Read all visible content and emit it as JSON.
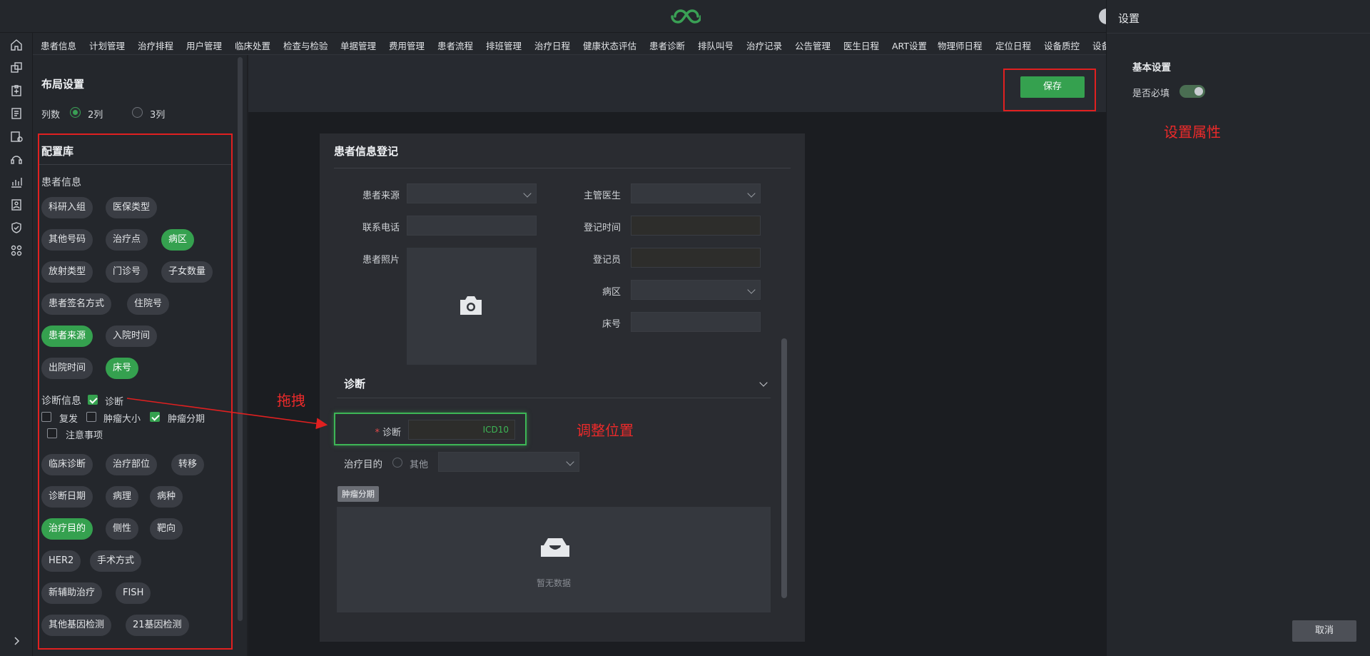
{
  "menu": [
    "患者信息",
    "计划管理",
    "治疗排程",
    "用户管理",
    "临床处置",
    "检查与检验",
    "单据管理",
    "费用管理",
    "患者流程",
    "排班管理",
    "治疗日程",
    "健康状态评估",
    "患者诊断",
    "排队叫号",
    "治疗记录",
    "公告管理",
    "医生日程",
    "ART设置",
    "物理师日程",
    "定位日程",
    "设备质控",
    "设备"
  ],
  "layout": {
    "title": "布局设置",
    "cols_label": "列数",
    "col2": "2列",
    "col3": "3列",
    "selected": "2列"
  },
  "library": {
    "title": "配置库",
    "patient_section": "患者信息",
    "patient_chips": [
      {
        "label": "科研入组",
        "active": false
      },
      {
        "label": "医保类型",
        "active": false
      },
      {
        "label": "其他号码",
        "active": false
      },
      {
        "label": "治疗点",
        "active": false
      },
      {
        "label": "病区",
        "active": true
      },
      {
        "label": "放射类型",
        "active": false
      },
      {
        "label": "门诊号",
        "active": false
      },
      {
        "label": "子女数量",
        "active": false
      },
      {
        "label": "患者签名方式",
        "active": false
      },
      {
        "label": "住院号",
        "active": false
      },
      {
        "label": "患者来源",
        "active": true
      },
      {
        "label": "入院时间",
        "active": false
      },
      {
        "label": "出院时间",
        "active": false
      },
      {
        "label": "床号",
        "active": true
      }
    ],
    "diag_section": "诊断信息",
    "diag_checks": [
      {
        "label": "诊断",
        "checked": true
      },
      {
        "label": "复发",
        "checked": false
      },
      {
        "label": "肿瘤大小",
        "checked": false
      },
      {
        "label": "肿瘤分期",
        "checked": true
      },
      {
        "label": "注意事项",
        "checked": false
      }
    ],
    "diag_chips": [
      {
        "label": "临床诊断",
        "active": false
      },
      {
        "label": "治疗部位",
        "active": false
      },
      {
        "label": "转移",
        "active": false
      },
      {
        "label": "诊断日期",
        "active": false
      },
      {
        "label": "病理",
        "active": false
      },
      {
        "label": "病种",
        "active": false
      },
      {
        "label": "治疗目的",
        "active": true
      },
      {
        "label": "侧性",
        "active": false
      },
      {
        "label": "靶向",
        "active": false
      },
      {
        "label": "HER2",
        "active": false
      },
      {
        "label": "手术方式",
        "active": false
      },
      {
        "label": "新辅助治疗",
        "active": false
      },
      {
        "label": "FISH",
        "active": false
      },
      {
        "label": "其他基因检测",
        "active": false
      },
      {
        "label": "21基因检测",
        "active": false
      }
    ]
  },
  "toolbar": {
    "save_label": "保存"
  },
  "form": {
    "title": "患者信息登记",
    "fields": {
      "source": "患者来源",
      "doctor": "主管医生",
      "phone": "联系电话",
      "reg_time": "登记时间",
      "photo": "患者照片",
      "registrar": "登记员",
      "ward": "病区",
      "bed": "床号"
    },
    "diag_title": "诊断",
    "diag_label": "诊断",
    "diag_required_mark": "*",
    "diag_placeholder": "ICD10",
    "goal_label": "治疗目的",
    "goal_other": "其他",
    "tumor_tag": "肿瘤分期",
    "empty_text": "暂无数据"
  },
  "drawer": {
    "title": "设置",
    "section": "基本设置",
    "required_label": "是否必填",
    "required_on": true,
    "cancel_label": "取消"
  },
  "annotations": {
    "drag": "拖拽",
    "adjust": "调整位置",
    "set_props": "设置属性"
  },
  "colors": {
    "accent": "#35a14f",
    "annotation": "#e02020"
  }
}
